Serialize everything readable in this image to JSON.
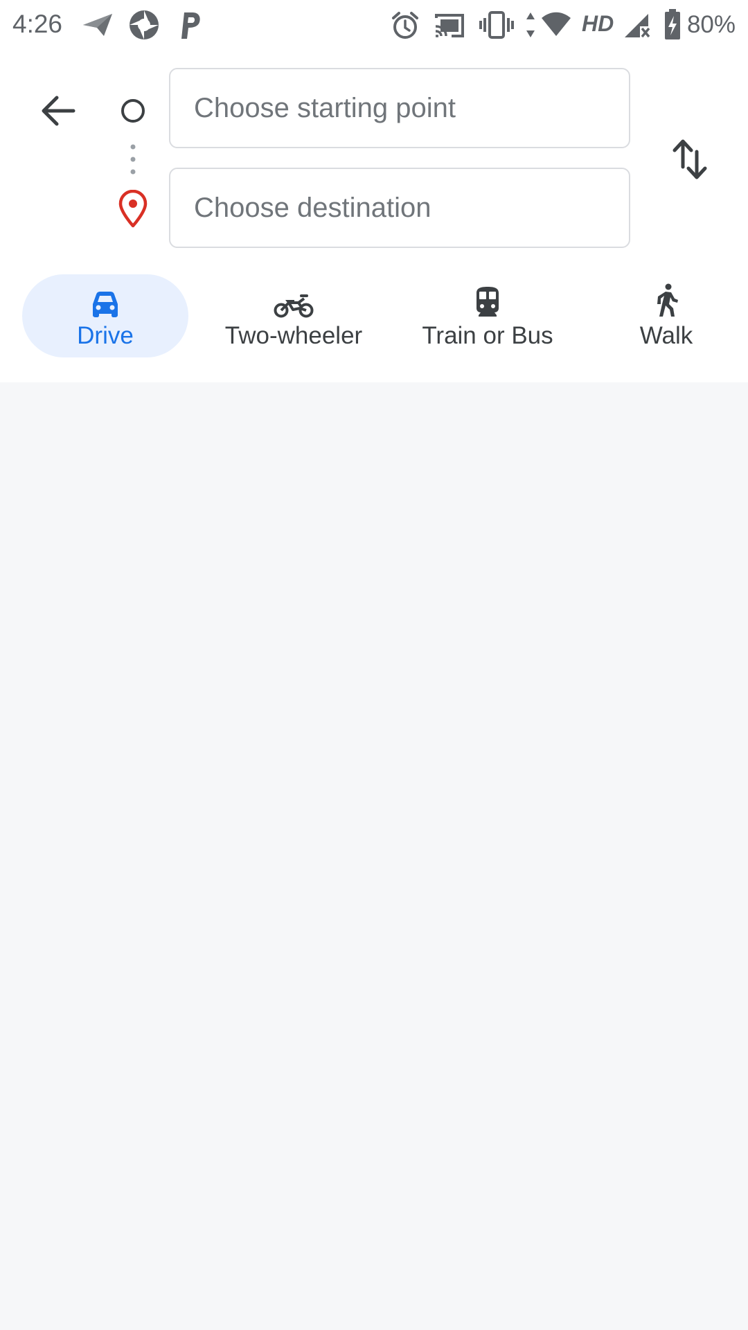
{
  "status_bar": {
    "time": "4:26",
    "battery_percent": "80%",
    "network_label": "HD",
    "icons": [
      "send-icon",
      "aperture-app-icon",
      "parking-app-icon",
      "alarm-icon",
      "cast-icon",
      "vibrate-icon",
      "data-arrows-icon",
      "wifi-icon",
      "cell-signal-icon",
      "battery-charging-icon"
    ]
  },
  "directions": {
    "start_placeholder": "Choose starting point",
    "destination_placeholder": "Choose destination",
    "start_value": "",
    "destination_value": ""
  },
  "modes": [
    {
      "label": "Drive",
      "icon": "car-icon",
      "selected": true
    },
    {
      "label": "Two-wheeler",
      "icon": "motorcycle-icon",
      "selected": false
    },
    {
      "label": "Train or Bus",
      "icon": "train-icon",
      "selected": false
    },
    {
      "label": "Walk",
      "icon": "walking-icon",
      "selected": false
    }
  ],
  "colors": {
    "accent": "#1a73e8",
    "selected_tab_bg": "#e8f0fe",
    "destination_pin": "#d93025",
    "content_bg": "#f6f7f9"
  }
}
